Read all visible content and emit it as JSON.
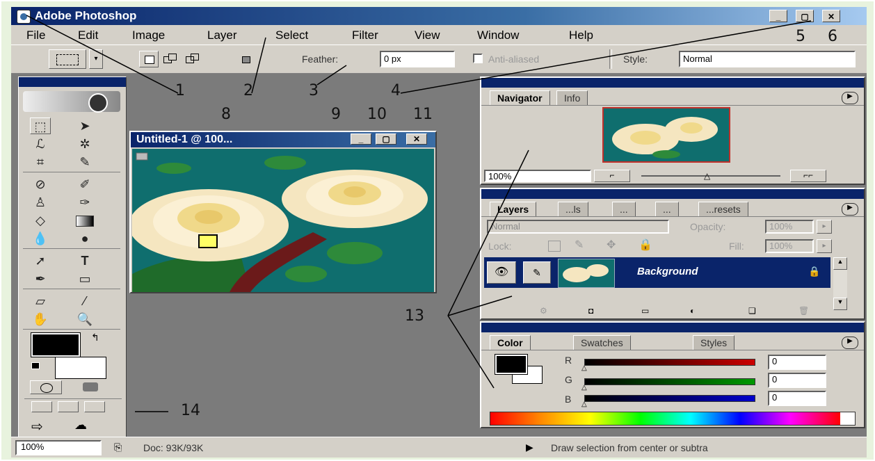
{
  "app": {
    "title": "Adobe Photoshop"
  },
  "menu": [
    "File",
    "Edit",
    "Image",
    "Layer",
    "Select",
    "Filter",
    "View",
    "Window",
    "Help"
  ],
  "options": {
    "feather_label": "Feather:",
    "feather_value": "0 px",
    "antialiased_label": "Anti-aliased",
    "style_label": "Style:",
    "style_value": "Normal"
  },
  "document": {
    "title": "Untitled-1 @ 100..."
  },
  "navigator": {
    "tabs": [
      "Navigator",
      "Info"
    ],
    "zoom_value": "100%"
  },
  "layers": {
    "tabs": [
      "Layers",
      "...ls",
      "...",
      "...",
      "...resets"
    ],
    "blend_mode": "Normal",
    "opacity_label": "Opacity:",
    "opacity_value": "100%",
    "lock_label": "Lock:",
    "fill_label": "Fill:",
    "fill_value": "100%",
    "layer_name": "Background"
  },
  "color": {
    "tabs": [
      "Color",
      "Swatches",
      "Styles"
    ],
    "channels": [
      {
        "label": "R",
        "value": "0",
        "color": "#cc0000"
      },
      {
        "label": "G",
        "value": "0",
        "color": "#009900"
      },
      {
        "label": "B",
        "value": "0",
        "color": "#0000cc"
      }
    ]
  },
  "status": {
    "zoom": "100%",
    "doc": "Doc: 93K/93K",
    "message": "Draw selection from center or subtra"
  },
  "callouts": [
    "1",
    "2",
    "3",
    "4",
    "5",
    "6",
    "8",
    "9",
    "10",
    "11",
    "13",
    "14"
  ],
  "colors": {
    "titlebar": "#0a246a",
    "chrome": "#d4d0c8",
    "workspace": "#7b7b7b",
    "canvas_bg": "#0f6e6e",
    "frame": "#e8f3de"
  }
}
